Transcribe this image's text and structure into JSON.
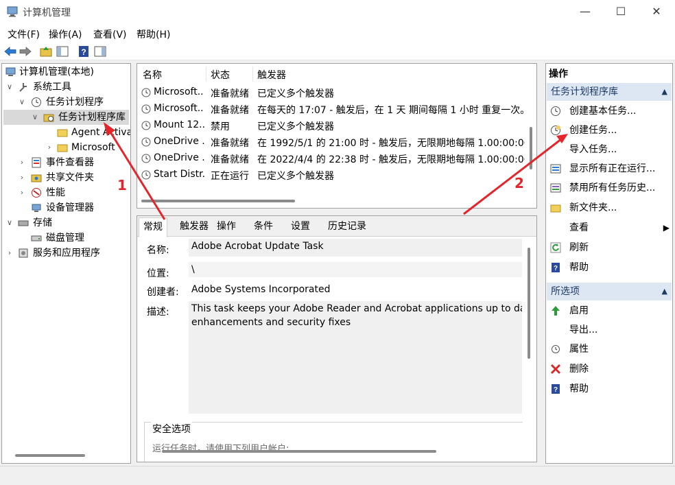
{
  "window": {
    "title": "计算机管理",
    "minimize": "—",
    "maximize": "☐",
    "close": "✕"
  },
  "menu": [
    "文件(F)",
    "操作(A)",
    "查看(V)",
    "帮助(H)"
  ],
  "tree": [
    {
      "label": "计算机管理(本地)"
    },
    {
      "label": "系统工具"
    },
    {
      "label": "任务计划程序"
    },
    {
      "label": "任务计划程序库"
    },
    {
      "label": "Agent Activa"
    },
    {
      "label": "Microsoft"
    },
    {
      "label": "事件查看器"
    },
    {
      "label": "共享文件夹"
    },
    {
      "label": "性能"
    },
    {
      "label": "设备管理器"
    },
    {
      "label": "存储"
    },
    {
      "label": "磁盘管理"
    },
    {
      "label": "服务和应用程序"
    }
  ],
  "task_list": {
    "headers": [
      "名称",
      "状态",
      "触发器"
    ],
    "rows": [
      {
        "name": "Microsoft...",
        "status": "准备就绪",
        "trigger": "已定义多个触发器"
      },
      {
        "name": "Microsoft...",
        "status": "准备就绪",
        "trigger": "在每天的 17:07 - 触发后，在 1 天 期间每隔 1 小时 重复一次。"
      },
      {
        "name": "Mount 12...",
        "status": "禁用",
        "trigger": "已定义多个触发器"
      },
      {
        "name": "OneDrive ...",
        "status": "准备就绪",
        "trigger": "在 1992/5/1 的 21:00 时 - 触发后，无限期地每隔 1.00:00:00 重"
      },
      {
        "name": "OneDrive ...",
        "status": "准备就绪",
        "trigger": "在 2022/4/4 的 22:38 时 - 触发后，无限期地每隔 1.00:00:00 重"
      },
      {
        "name": "Start Distr...",
        "status": "正在运行",
        "trigger": "已定义多个触发器"
      }
    ]
  },
  "details": {
    "tabs": [
      "常规",
      "触发器",
      "操作",
      "条件",
      "设置",
      "历史记录"
    ],
    "name_label": "名称:",
    "name_value": "Adobe Acrobat Update Task",
    "location_label": "位置:",
    "location_value": "\\",
    "author_label": "创建者:",
    "author_value": "Adobe Systems Incorporated",
    "desc_label": "描述:",
    "desc_value_line1": "This task keeps your Adobe Reader and Acrobat applications up to date",
    "desc_value_line2": "enhancements and security fixes",
    "security_label": "安全选项",
    "security_cut": "运行任务时，请使用下列用户帐户:"
  },
  "actions": {
    "header": "操作",
    "section1": "任务计划程序库",
    "items1": [
      "创建基本任务...",
      "创建任务...",
      "导入任务...",
      "显示所有正在运行...",
      "禁用所有任务历史...",
      "新文件夹...",
      "查看",
      "刷新",
      "帮助"
    ],
    "section2": "所选项",
    "items2": [
      "启用",
      "导出...",
      "属性",
      "删除",
      "帮助"
    ]
  },
  "annotations": {
    "label1": "1",
    "label2": "2"
  },
  "colors": {
    "accent": "#1c5fb8",
    "annotation": "#e3262b",
    "section_bg": "#dde7f4"
  }
}
